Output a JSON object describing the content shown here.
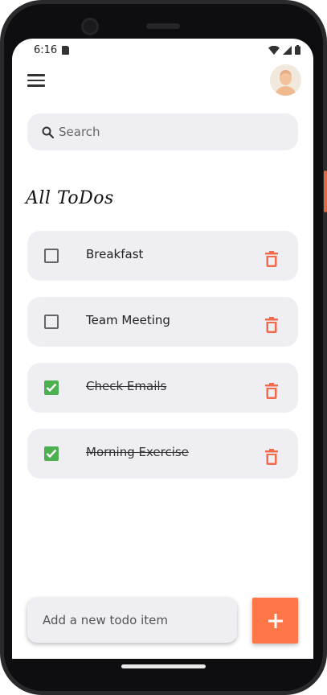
{
  "status_bar": {
    "time": "6:16"
  },
  "header": {
    "menu_icon": "menu-icon",
    "avatar_icon": "avatar"
  },
  "search": {
    "placeholder": "Search",
    "value": ""
  },
  "section_title": "All ToDos",
  "todos": [
    {
      "text": "Breakfast",
      "done": false
    },
    {
      "text": "Team Meeting",
      "done": false
    },
    {
      "text": "Check Emails",
      "done": true
    },
    {
      "text": "Morning Exercise",
      "done": true
    }
  ],
  "add_todo": {
    "placeholder": "Add a new todo item",
    "value": "",
    "button_icon": "plus-icon"
  },
  "colors": {
    "accent": "#ff7648",
    "delete": "#f06a4b",
    "checked": "#4caf50",
    "card_bg": "#eeeef3"
  }
}
